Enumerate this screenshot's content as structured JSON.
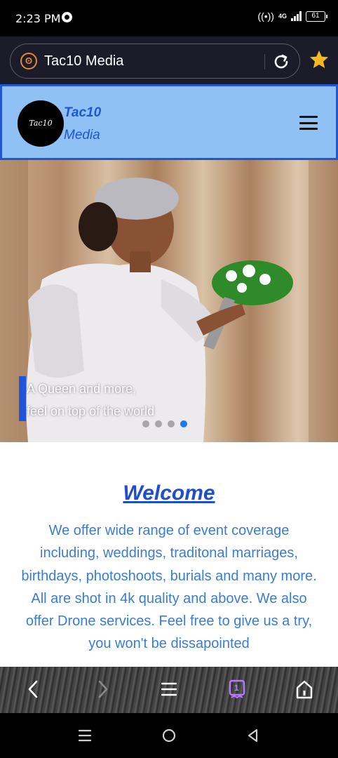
{
  "status_bar": {
    "time": "2:23 PM",
    "network": "4G",
    "battery": "61"
  },
  "browser": {
    "site_title": "Tac10 Media",
    "accent_color": "#e5892a",
    "star_color": "#f5b820"
  },
  "site_header": {
    "logo_text": "Tac10",
    "brand_line1": "Tac10",
    "brand_line2": "Media",
    "background": "#8fc1f5",
    "brand_color": "#1f55d6"
  },
  "hero": {
    "caption_line1": "A Queen and more,",
    "caption_line2": "feel on top of the world",
    "slides": 4,
    "active_slide": 4
  },
  "welcome": {
    "title": "Welcome",
    "body": "We offer wide range of event coverage including, weddings, traditonal marriages, birthdays, photoshoots, burials and many more. All are shot in 4k quality and above. We also offer Drone services. Feel free to give us a try, you won't be dissapointed"
  },
  "bottom_nav": {
    "tab_count": "1",
    "icons": [
      "back-icon",
      "forward-icon",
      "menu-icon",
      "tabs-icon",
      "home-icon"
    ]
  },
  "system_nav": {
    "icons": [
      "recents-icon",
      "home-circle-icon",
      "back-triangle-icon"
    ]
  }
}
